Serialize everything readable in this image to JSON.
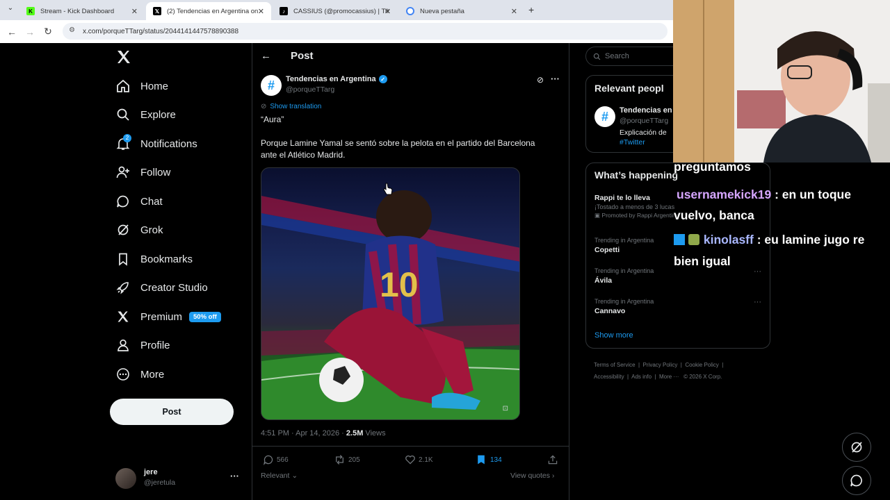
{
  "browser": {
    "tabs": [
      {
        "title": "Stream - Kick Dashboard",
        "icon": "kick-icon",
        "color": "#53fc18"
      },
      {
        "title": "(2) Tendencias en Argentina on",
        "icon": "x-icon",
        "color": "#000000"
      },
      {
        "title": "CASSIUS (@promocassius) | Tik",
        "icon": "tiktok-icon",
        "color": "#000000"
      },
      {
        "title": "Nueva pestaña",
        "icon": "chrome-icon",
        "color": "#4285f4"
      }
    ],
    "url": "x.com/porqueTTarg/status/2044141447578890388"
  },
  "sidebar": {
    "items": [
      {
        "label": "Home",
        "icon": "home-icon"
      },
      {
        "label": "Explore",
        "icon": "search-icon"
      },
      {
        "label": "Notifications",
        "icon": "bell-icon",
        "badge": "2"
      },
      {
        "label": "Follow",
        "icon": "follow-icon"
      },
      {
        "label": "Chat",
        "icon": "chat-icon"
      },
      {
        "label": "Grok",
        "icon": "grok-icon"
      },
      {
        "label": "Bookmarks",
        "icon": "bookmark-icon"
      },
      {
        "label": "Creator Studio",
        "icon": "rocket-icon"
      },
      {
        "label": "Premium",
        "icon": "x-icon",
        "badge": "50% off"
      },
      {
        "label": "Profile",
        "icon": "profile-icon"
      },
      {
        "label": "More",
        "icon": "more-icon"
      }
    ],
    "post_label": "Post",
    "account": {
      "name": "jere",
      "handle": "@jeretula"
    }
  },
  "post": {
    "header_title": "Post",
    "author_name": "Tendencias en Argentina",
    "author_handle": "@porqueTTarg",
    "show_translation": "Show translation",
    "text_line1": "“Aura”",
    "text_body": "Porque Lamine Yamal se sentó sobre la pelota en el partido del Barcelona ante el Atlético Madrid.",
    "time": "4:51 PM · Apr 14, 2026 · ",
    "views": "2.5M",
    "views_label": " Views",
    "replies": "566",
    "reposts": "205",
    "likes": "2.1K",
    "bookmarks": "134",
    "sort_label": "Relevant",
    "view_quotes": "View quotes"
  },
  "right": {
    "search_placeholder": "Search",
    "relevant_title": "Relevant peopl",
    "relevant_name": "Tendencias en",
    "relevant_handle": "@porqueTTarg",
    "relevant_bio": "Explicación de",
    "relevant_tag": "#Twitter",
    "happening_title": "What’s happening",
    "promo_title": "Rappi te lo lleva",
    "promo_sub": "¡Tostado a menos de 3 lucas",
    "promo_by": "Promoted by Rappi Argentina",
    "trends": [
      {
        "category": "Trending in Argentina",
        "name": "Copetti"
      },
      {
        "category": "Trending in Argentina",
        "name": "Ávila"
      },
      {
        "category": "Trending in Argentina",
        "name": "Cannavo"
      }
    ],
    "show_more": "Show more",
    "footer_links": [
      "Terms of Service",
      "Privacy Policy",
      "Cookie Policy",
      "Accessibility",
      "Ads info",
      "More ···",
      "© 2026 X Corp."
    ]
  },
  "chat_overlay": {
    "msg0_text": "preguntamos",
    "msg1_user": "usernamekick19",
    "msg1_text": " : en un toque vuelvo, banca",
    "msg2_user": "kinolasff",
    "msg2_text": " : eu lamine jugo re bien igual"
  }
}
